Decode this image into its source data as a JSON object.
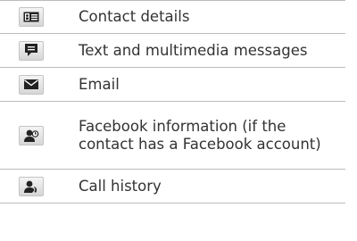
{
  "items": [
    {
      "icon": "contact-card-icon",
      "label": "Contact details"
    },
    {
      "icon": "message-bubble-icon",
      "label": "Text and multimedia messages"
    },
    {
      "icon": "envelope-icon",
      "label": "Email"
    },
    {
      "icon": "facebook-person-icon",
      "label": "Facebook information (if the contact has a Facebook account)"
    },
    {
      "icon": "call-history-icon",
      "label": "Call history"
    }
  ],
  "colors": {
    "icon_dark": "#222222",
    "divider": "#bcbcbc",
    "text": "#333333"
  }
}
